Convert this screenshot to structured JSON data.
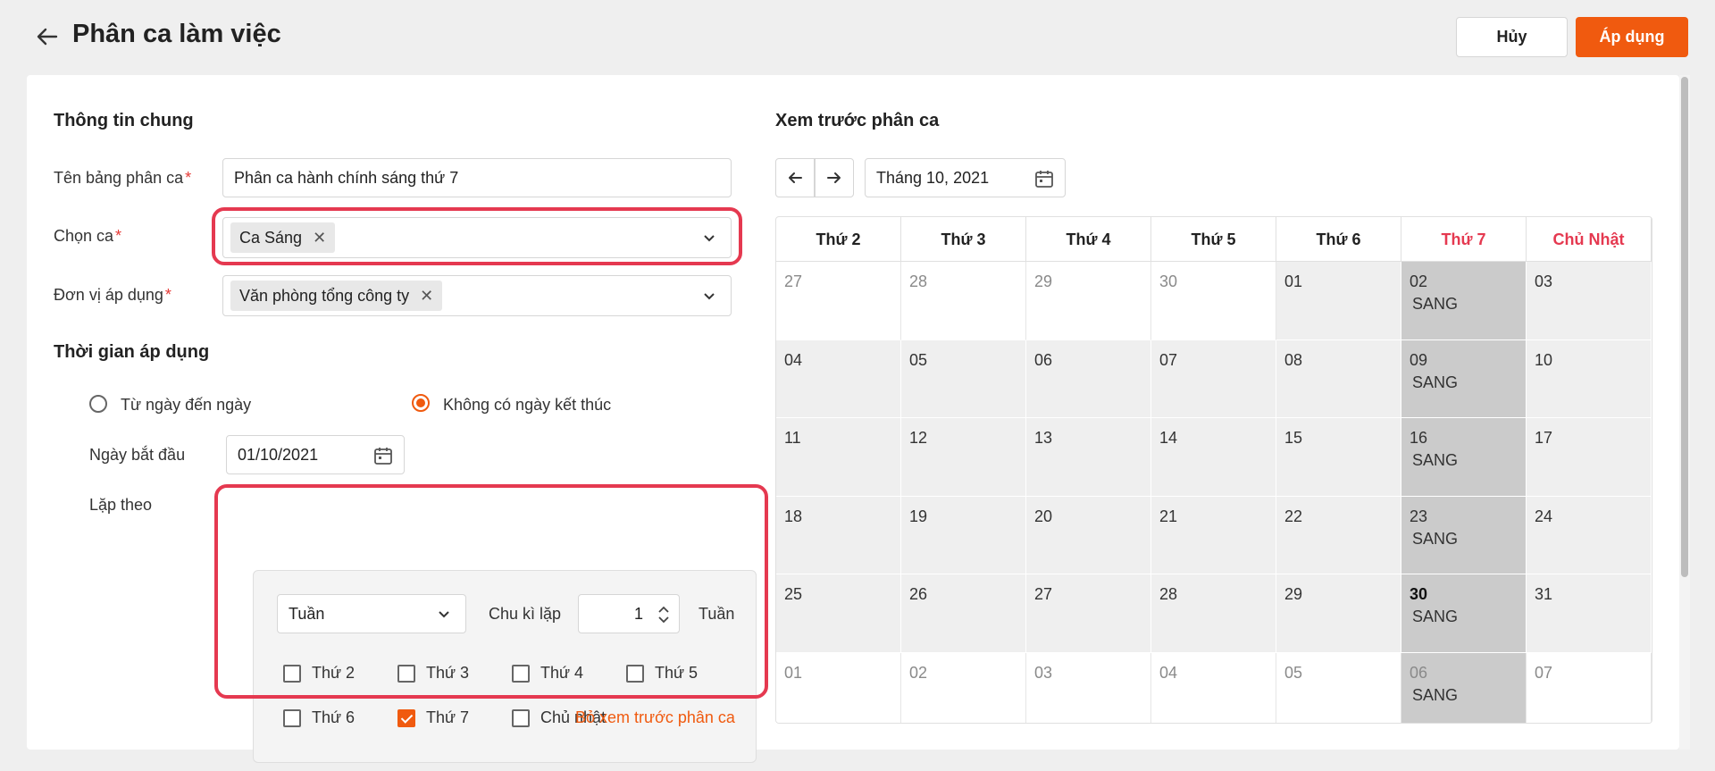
{
  "header": {
    "title": "Phân ca làm việc",
    "cancel_label": "Hủy",
    "apply_label": "Áp dụng"
  },
  "general": {
    "section_title": "Thông tin chung",
    "name_label": "Tên bảng phân ca",
    "name_value": "Phân ca hành chính sáng thứ 7",
    "shift_label": "Chọn ca",
    "shift_tag": "Ca Sáng",
    "unit_label": "Đơn vị áp dụng",
    "unit_tag": "Văn phòng tổng công ty",
    "required_mark": "*"
  },
  "time": {
    "section_title": "Thời gian áp dụng",
    "option_range": "Từ ngày đến ngày",
    "option_no_end": "Không có ngày kết thúc",
    "selected_option": "Không có ngày kết thúc",
    "start_label": "Ngày bắt đầu",
    "start_value": "01/10/2021",
    "repeat_label": "Lặp theo",
    "repeat_type": "Tuần",
    "cycle_label": "Chu kì lặp",
    "cycle_value": "1",
    "cycle_unit": "Tuần",
    "days": [
      {
        "label": "Thứ 2",
        "checked": false
      },
      {
        "label": "Thứ 3",
        "checked": false
      },
      {
        "label": "Thứ 4",
        "checked": false
      },
      {
        "label": "Thứ 5",
        "checked": false
      },
      {
        "label": "Thứ 6",
        "checked": false
      },
      {
        "label": "Thứ 7",
        "checked": true
      },
      {
        "label": "Chủ nhật",
        "checked": false
      }
    ],
    "hide_preview_link": "Bỏ xem trước phân ca"
  },
  "preview": {
    "section_title": "Xem trước phân ca",
    "month_value": "Tháng 10, 2021",
    "weekdays": [
      "Thứ 2",
      "Thứ 3",
      "Thứ 4",
      "Thứ 5",
      "Thứ 6",
      "Thứ 7",
      "Chủ Nhật"
    ],
    "shift_code": "SANG",
    "weeks": [
      [
        {
          "d": "27",
          "in": false
        },
        {
          "d": "28",
          "in": false
        },
        {
          "d": "29",
          "in": false
        },
        {
          "d": "30",
          "in": false
        },
        {
          "d": "01",
          "in": true
        },
        {
          "d": "02",
          "in": true,
          "shift": true
        },
        {
          "d": "03",
          "in": true
        }
      ],
      [
        {
          "d": "04",
          "in": true
        },
        {
          "d": "05",
          "in": true
        },
        {
          "d": "06",
          "in": true
        },
        {
          "d": "07",
          "in": true
        },
        {
          "d": "08",
          "in": true
        },
        {
          "d": "09",
          "in": true,
          "shift": true
        },
        {
          "d": "10",
          "in": true
        }
      ],
      [
        {
          "d": "11",
          "in": true
        },
        {
          "d": "12",
          "in": true
        },
        {
          "d": "13",
          "in": true
        },
        {
          "d": "14",
          "in": true
        },
        {
          "d": "15",
          "in": true
        },
        {
          "d": "16",
          "in": true,
          "shift": true
        },
        {
          "d": "17",
          "in": true
        }
      ],
      [
        {
          "d": "18",
          "in": true
        },
        {
          "d": "19",
          "in": true
        },
        {
          "d": "20",
          "in": true
        },
        {
          "d": "21",
          "in": true
        },
        {
          "d": "22",
          "in": true
        },
        {
          "d": "23",
          "in": true,
          "shift": true
        },
        {
          "d": "24",
          "in": true
        }
      ],
      [
        {
          "d": "25",
          "in": true
        },
        {
          "d": "26",
          "in": true
        },
        {
          "d": "27",
          "in": true
        },
        {
          "d": "28",
          "in": true
        },
        {
          "d": "29",
          "in": true
        },
        {
          "d": "30",
          "in": true,
          "shift": true,
          "today": true
        },
        {
          "d": "31",
          "in": true
        }
      ],
      [
        {
          "d": "01",
          "in": false
        },
        {
          "d": "02",
          "in": false
        },
        {
          "d": "03",
          "in": false
        },
        {
          "d": "04",
          "in": false
        },
        {
          "d": "05",
          "in": false
        },
        {
          "d": "06",
          "in": false,
          "shift": true
        },
        {
          "d": "07",
          "in": false
        }
      ]
    ]
  },
  "colors": {
    "accent": "#f05a0f",
    "highlight": "#e53950",
    "weekend_header": "#e53950",
    "shift_cell": "#cbcbcb"
  }
}
